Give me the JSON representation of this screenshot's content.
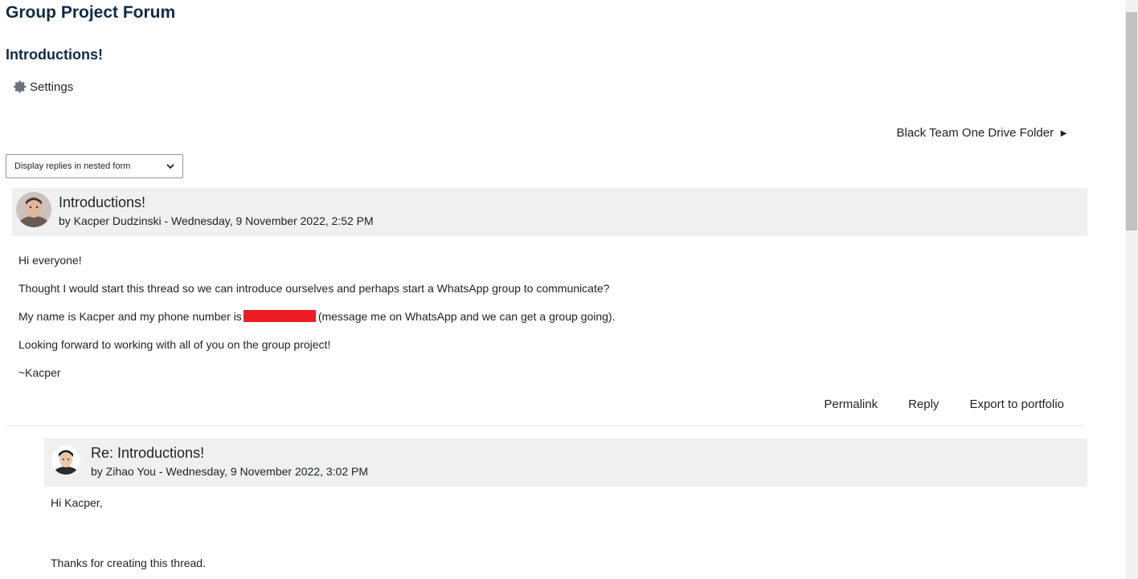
{
  "page": {
    "title": "Group Project Forum",
    "discussion_title": "Introductions!",
    "settings_label": "Settings",
    "nav_link": "Black Team One Drive Folder",
    "nav_arrow": "►",
    "display_mode": "Display replies in nested form"
  },
  "posts": [
    {
      "subject": "Introductions!",
      "byline": "by Kacper Dudzinski - Wednesday, 9 November 2022, 2:52 PM",
      "lines": [
        "Hi everyone!",
        "Thought I would start this thread so we can introduce ourselves and perhaps start a WhatsApp group to communicate?",
        "My name is Kacper and my phone number is",
        "(message me on WhatsApp and we can get a group going).",
        "Looking forward to working with all of you on the group project!",
        "~Kacper"
      ],
      "actions": [
        "Permalink",
        "Reply",
        "Export to portfolio"
      ]
    },
    {
      "subject": "Re: Introductions!",
      "byline": "by Zihao You - Wednesday, 9 November 2022, 3:02 PM",
      "lines": [
        "Hi Kacper,",
        "Thanks for creating this thread."
      ]
    }
  ],
  "colors": {
    "heading": "#0f2b47",
    "post_header_bg": "#f0f0f0",
    "redaction": "#ed1c24"
  }
}
